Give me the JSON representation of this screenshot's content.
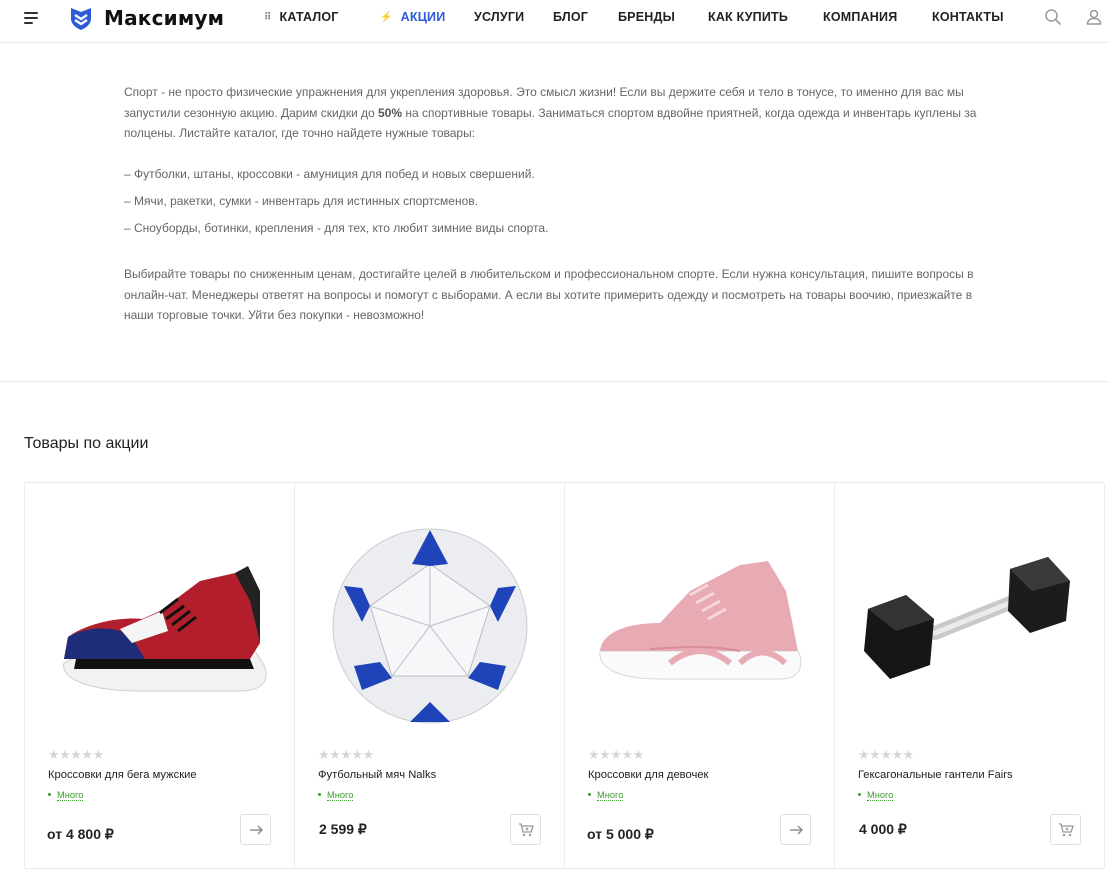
{
  "header": {
    "logo_text": "Максимум",
    "nav": [
      {
        "label": "КАТАЛОГ"
      },
      {
        "label": "АКЦИИ",
        "active": true
      },
      {
        "label": "УСЛУГИ"
      },
      {
        "label": "БЛОГ"
      },
      {
        "label": "БРЕНДЫ"
      },
      {
        "label": "КАК КУПИТЬ"
      },
      {
        "label": "КОМПАНИЯ"
      },
      {
        "label": "КОНТАКТЫ"
      }
    ],
    "accent_color": "#2d5ad7"
  },
  "promo": {
    "p1_before": "Спорт - не просто физические упражнения для укрепления здоровья. Это смысл жизни! Если вы держите себя и тело в тонусе, то именно для вас мы запустили сезонную акцию. Дарим скидки до ",
    "p1_bold": "50%",
    "p1_after": " на спортивные товары. Заниматься спортом вдвойне приятней, когда одежда и инвентарь куплены за полцены. Листайте каталог, где точно найдете нужные товары:",
    "bullets": [
      "–  Футболки, штаны, кроссовки - амуниция для побед и новых свершений.",
      "–  Мячи, ракетки, сумки - инвентарь для истинных спортсменов.",
      "–  Сноуборды, ботинки, крепления - для тех, кто любит зимние виды спорта."
    ],
    "p2": "Выбирайте товары по сниженным ценам, достигайте целей в любительском и профессиональном спорте. Если нужна консультация, пишите вопросы в онлайн-чат. Менеджеры ответят на вопросы и помогут с выборами. А если вы хотите примерить одежду и посмотреть на товары воочию, приезжайте в наши торговые точки. Уйти без покупки - невозможно!"
  },
  "section_title": "Товары по акции",
  "products": [
    {
      "name": "Кроссовки для бега мужские",
      "stock": "Много",
      "price": "от 4 800 ₽",
      "rating": 0,
      "action": "arrow-right-icon"
    },
    {
      "name": "Футбольный мяч Nalks",
      "stock": "Много",
      "price": "2 599 ₽",
      "rating": 0,
      "action": "cart-icon"
    },
    {
      "name": "Кроссовки для девочек",
      "stock": "Много",
      "price": "от 5 000 ₽",
      "rating": 0,
      "action": "arrow-right-icon"
    },
    {
      "name": "Гексагональные гантели Fairs",
      "stock": "Много",
      "price": "4 000 ₽",
      "rating": 0,
      "action": "cart-icon"
    }
  ],
  "stars_text": "★★★★★",
  "stock_color": "#3c9e2d"
}
